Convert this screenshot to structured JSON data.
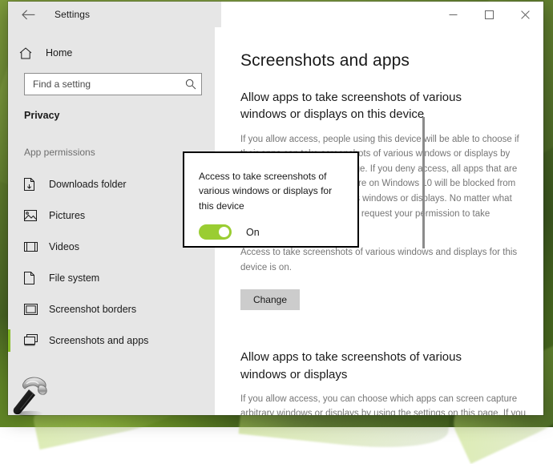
{
  "window": {
    "app_title": "Settings",
    "back_icon": "back-arrow-icon",
    "controls": {
      "minimize": "–",
      "maximize": "☐",
      "close": "✕"
    }
  },
  "sidebar": {
    "home": {
      "label": "Home",
      "icon": "home-icon"
    },
    "search": {
      "value": "",
      "placeholder": "Find a setting",
      "icon": "search-icon"
    },
    "category": "Privacy",
    "group_label": "App permissions",
    "items": [
      {
        "label": "Downloads folder",
        "icon": "downloads-folder-icon",
        "selected": false
      },
      {
        "label": "Pictures",
        "icon": "pictures-icon",
        "selected": false
      },
      {
        "label": "Videos",
        "icon": "videos-icon",
        "selected": false
      },
      {
        "label": "File system",
        "icon": "file-system-icon",
        "selected": false
      },
      {
        "label": "Screenshot borders",
        "icon": "screenshot-borders-icon",
        "selected": false
      },
      {
        "label": "Screenshots and apps",
        "icon": "screenshots-and-apps-icon",
        "selected": true
      }
    ]
  },
  "main": {
    "page_title": "Screenshots and apps",
    "section1": {
      "heading": "Allow apps to take screenshots of various windows or displays on this device",
      "body": "If you allow access, people using this device will be able to choose if their apps can take screenshots of various windows or displays by using the settings on this page. If you deny access, all apps that are available in the Microsoft Store on Windows 10 will be blocked from taking screenshots of various windows or displays. No matter what you choose, apps will always request your permission to take screenshots.",
      "status": "Access to take screenshots of various windows and displays for this device is on.",
      "change_label": "Change"
    },
    "section2": {
      "heading": "Allow apps to take screenshots of various windows or displays",
      "body": "If you allow access, you can choose which apps can screen capture arbitrary windows or displays by using the settings on this page. If you deny access, apps that are available in the Microsoft Store on Windows 10 will be blocked from using screen capture on arbitrary windows or displays."
    }
  },
  "flyout": {
    "text": "Access to take screenshots of various windows or displays for this device",
    "toggle_state": "On",
    "toggle_on": true
  },
  "cursor": {
    "icon": "hammer-cursor-icon"
  },
  "colors": {
    "accent_green": "#86bc25",
    "toggle_green": "#9acd32",
    "sidebar_bg": "#e6e6e6",
    "content_bg": "#ffffff",
    "body_text": "#767676",
    "button_bg": "#cccccc"
  }
}
